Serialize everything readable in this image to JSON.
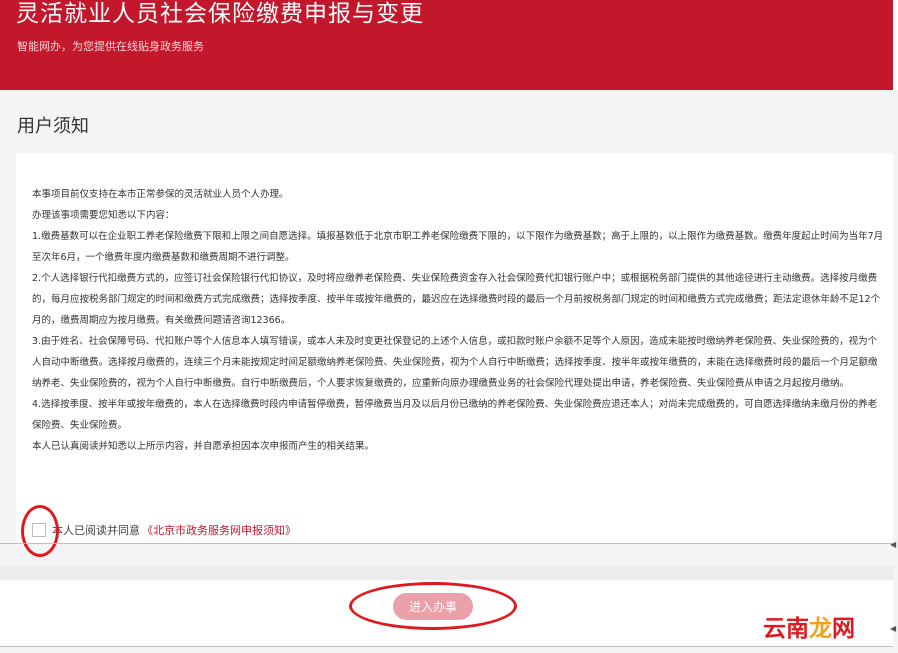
{
  "header": {
    "title": "灵活就业人员社会保险缴费申报与变更",
    "subtitle": "智能网办，为您提供在线贴身政务服务"
  },
  "section": {
    "title": "用户须知"
  },
  "notice": {
    "lines": [
      "本事项目前仅支持在本市正常参保的灵活就业人员个人办理。",
      "办理该事项需要您知悉以下内容：",
      "1.缴费基数可以在企业职工养老保险缴费下限和上限之间自愿选择。填报基数低于北京市职工养老保险缴费下限的，以下限作为缴费基数；高于上限的，以上限作为缴费基数。缴费年度起止时间为当年7月至次年6月，一个缴费年度内缴费基数和缴费周期不进行调整。",
      "2.个人选择银行代扣缴费方式的，应签订社会保险银行代扣协议，及时将应缴养老保险费、失业保险费资金存入社会保险费代扣银行账户中；或根据税务部门提供的其他途径进行主动缴费。选择按月缴费的，每月应按税务部门规定的时间和缴费方式完成缴费；选择按季度、按半年或按年缴费的，最迟应在选择缴费时段的最后一个月前按税务部门规定的时间和缴费方式完成缴费；距法定退休年龄不足12个月的，缴费周期应为按月缴费。有关缴费问题请咨询12366。",
      "3.由于姓名、社会保障号码、代扣账户等个人信息本人填写错误，或本人未及时变更社保登记的上述个人信息，或扣款时账户余额不足等个人原因，造成未能按时缴纳养老保险费、失业保险费的，视为个人自动中断缴费。选择按月缴费的，连续三个月未能按规定时间足额缴纳养老保险费、失业保险费，视为个人自行中断缴费；选择按季度、按半年或按年缴费的，未能在选择缴费时段的最后一个月足额缴纳养老、失业保险费的，视为个人自行中断缴费。自行中断缴费后，个人要求恢复缴费的，应重新向原办理缴费业务的社会保险代理处提出申请，养老保险费、失业保险费从申请之月起按月缴纳。",
      "4.选择按季度、按半年或按年缴费的，本人在选择缴费时段内申请暂停缴费，暂停缴费当月及以后月份已缴纳的养老保险费、失业保险费应退还本人；对尚未完成缴费的，可自愿选择缴纳未缴月份的养老保险费、失业保险费。",
      "本人已认真阅读并知悉以上所示内容，并自愿承担因本次申报而产生的相关结果。"
    ]
  },
  "agreement": {
    "text": "本人已阅读并同意",
    "link": "《北京市政务服务网申报须知》",
    "checked": false
  },
  "actions": {
    "submit_label": "进入办事"
  },
  "watermark": {
    "part1": "云南",
    "part2": "龙",
    "part3": "网"
  },
  "colors": {
    "brand": "#c3172b",
    "button_disabled": "#eaa0a8",
    "annotation": "#e0191f"
  }
}
